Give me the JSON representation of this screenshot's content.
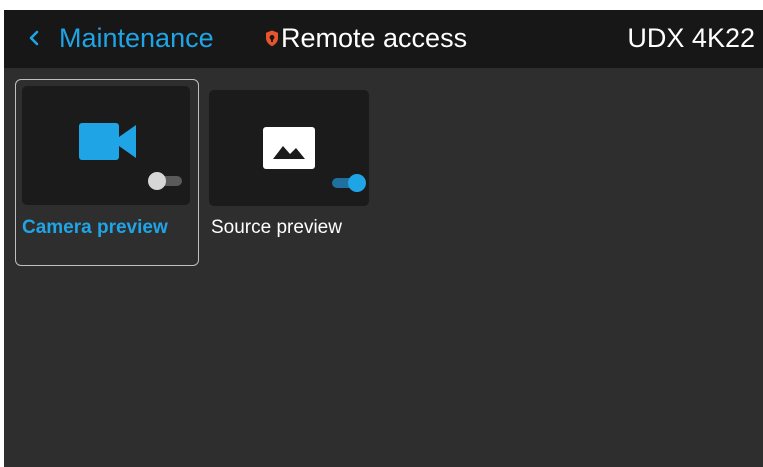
{
  "header": {
    "back_label": "Maintenance",
    "title": "Remote access",
    "device_name": "UDX 4K22"
  },
  "tiles": [
    {
      "label": "Camera preview",
      "icon": "video-camera-icon",
      "toggle_state": "off",
      "selected": true
    },
    {
      "label": "Source preview",
      "icon": "image-icon",
      "toggle_state": "on",
      "selected": false
    }
  ],
  "colors": {
    "accent": "#1fa4e6",
    "shield": "#e8542b",
    "topbar": "#171717",
    "background": "#2e2e2e",
    "card": "#1b1b1b"
  }
}
